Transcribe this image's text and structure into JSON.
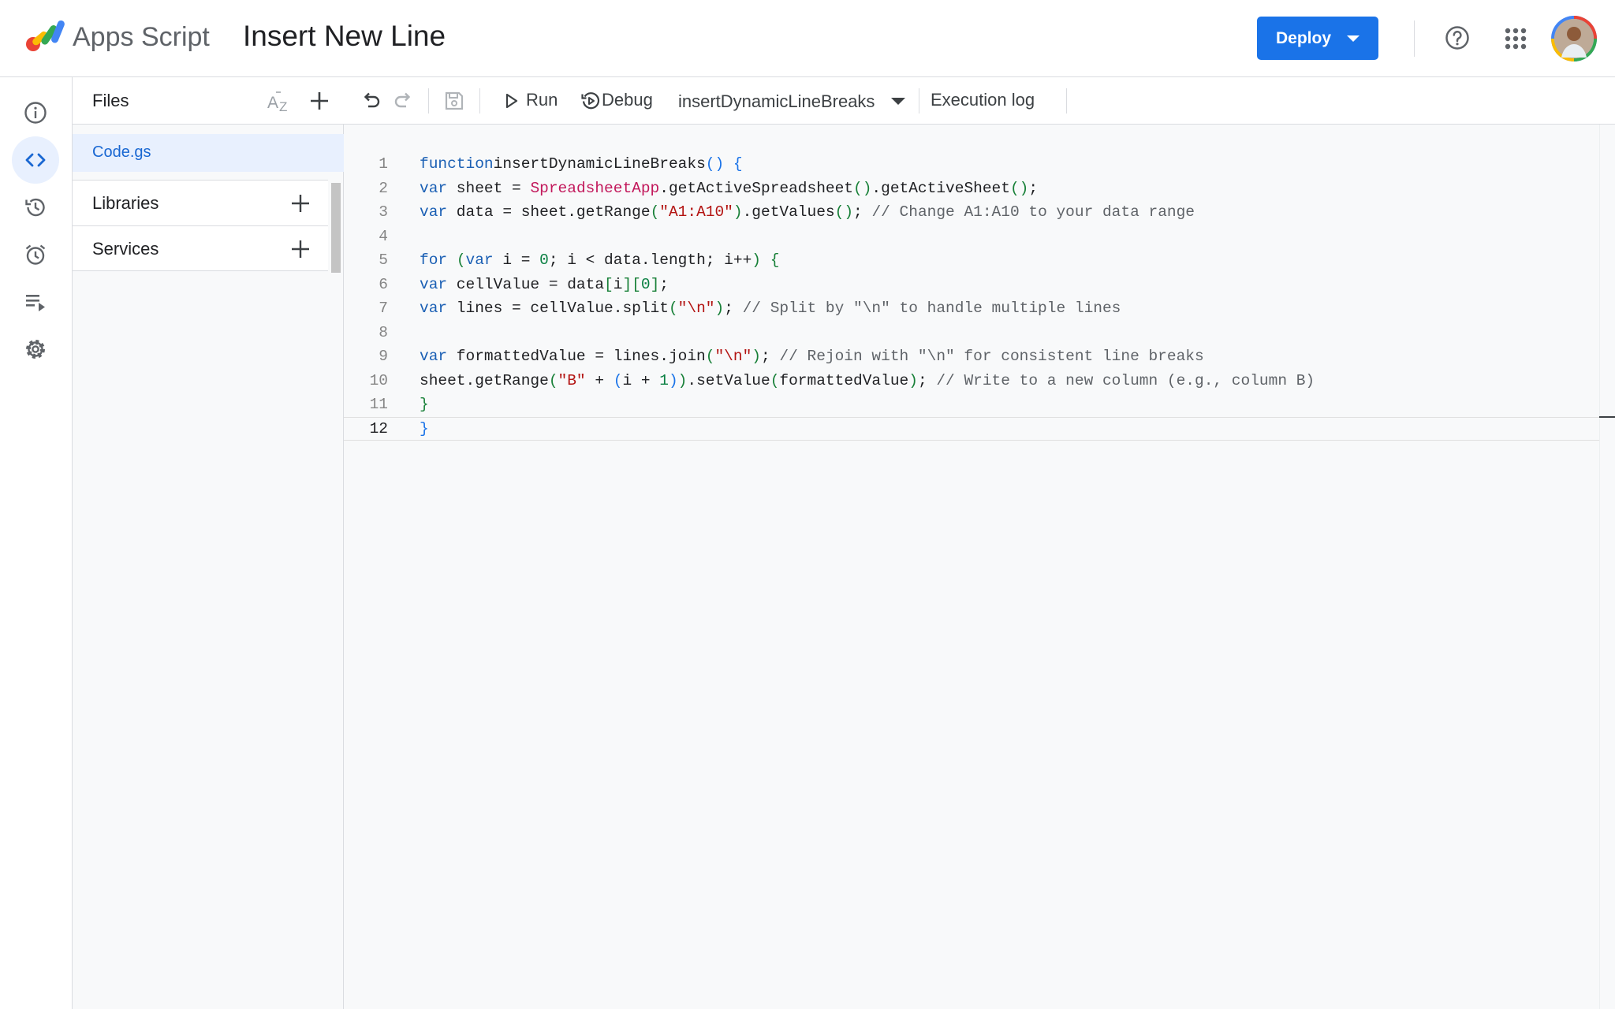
{
  "header": {
    "app_name": "Apps Script",
    "project_title": "Insert New Line",
    "deploy_label": "Deploy"
  },
  "leftnav": {
    "items": [
      {
        "name": "overview",
        "icon": "info-icon"
      },
      {
        "name": "editor",
        "icon": "code-icon",
        "active": true
      },
      {
        "name": "project-history",
        "icon": "history-icon"
      },
      {
        "name": "triggers",
        "icon": "alarm-clock-icon"
      },
      {
        "name": "executions",
        "icon": "executions-list-icon"
      },
      {
        "name": "project-settings",
        "icon": "gear-icon"
      }
    ]
  },
  "files_panel": {
    "title": "Files",
    "files": [
      "Code.gs"
    ],
    "libraries_label": "Libraries",
    "services_label": "Services"
  },
  "toolbar": {
    "run_label": "Run",
    "debug_label": "Debug",
    "function_name": "insertDynamicLineBreaks",
    "execution_log_label": "Execution log"
  },
  "editor": {
    "current_line": 12,
    "lines": [
      {
        "n": "1",
        "tokens": [
          [
            "kw",
            "function"
          ],
          [
            "",
            "insertDynamicLineBreaks"
          ],
          [
            "pb",
            "()"
          ],
          [
            "",
            " "
          ],
          [
            "pb",
            "{"
          ]
        ]
      },
      {
        "n": "2",
        "tokens": [
          [
            "kw",
            "var"
          ],
          [
            "",
            " sheet = "
          ],
          [
            "cls",
            "SpreadsheetApp"
          ],
          [
            "",
            ".getActiveSpreadsheet"
          ],
          [
            "pg",
            "()"
          ],
          [
            "",
            ".getActiveSheet"
          ],
          [
            "pg",
            "()"
          ],
          [
            "",
            ";"
          ]
        ]
      },
      {
        "n": "3",
        "tokens": [
          [
            "kw",
            "var"
          ],
          [
            "",
            " data = sheet.getRange"
          ],
          [
            "pg",
            "("
          ],
          [
            "str",
            "\"A1:A10\""
          ],
          [
            "pg",
            ")"
          ],
          [
            "",
            ".getValues"
          ],
          [
            "pg",
            "()"
          ],
          [
            "",
            "; "
          ],
          [
            "cm",
            "// Change A1:A10 to your data range"
          ]
        ]
      },
      {
        "n": "4",
        "tokens": []
      },
      {
        "n": "5",
        "tokens": [
          [
            "kw",
            "for"
          ],
          [
            "",
            " "
          ],
          [
            "pg",
            "("
          ],
          [
            "kw",
            "var"
          ],
          [
            "",
            " i = "
          ],
          [
            "num",
            "0"
          ],
          [
            "",
            "; i < data.length; i++"
          ],
          [
            "pg",
            ")"
          ],
          [
            "",
            " "
          ],
          [
            "pg",
            "{"
          ]
        ]
      },
      {
        "n": "6",
        "tokens": [
          [
            "kw",
            "var"
          ],
          [
            "",
            " cellValue = data"
          ],
          [
            "pg",
            "["
          ],
          [
            "",
            "i"
          ],
          [
            "pg",
            "]"
          ],
          [
            "pg",
            "["
          ],
          [
            "num",
            "0"
          ],
          [
            "pg",
            "]"
          ],
          [
            "",
            ";"
          ]
        ]
      },
      {
        "n": "7",
        "tokens": [
          [
            "kw",
            "var"
          ],
          [
            "",
            " lines = cellValue.split"
          ],
          [
            "pg",
            "("
          ],
          [
            "str",
            "\"\\n\""
          ],
          [
            "pg",
            ")"
          ],
          [
            "",
            "; "
          ],
          [
            "cm",
            "// Split by \"\\n\" to handle multiple lines"
          ]
        ]
      },
      {
        "n": "8",
        "tokens": []
      },
      {
        "n": "9",
        "tokens": [
          [
            "kw",
            "var"
          ],
          [
            "",
            " formattedValue = lines.join"
          ],
          [
            "pg",
            "("
          ],
          [
            "str",
            "\"\\n\""
          ],
          [
            "pg",
            ")"
          ],
          [
            "",
            "; "
          ],
          [
            "cm",
            "// Rejoin with \"\\n\" for consistent line breaks"
          ]
        ]
      },
      {
        "n": "10",
        "tokens": [
          [
            "",
            "sheet.getRange"
          ],
          [
            "pg",
            "("
          ],
          [
            "str",
            "\"B\""
          ],
          [
            "",
            " + "
          ],
          [
            "pb",
            "("
          ],
          [
            "",
            "i + "
          ],
          [
            "num",
            "1"
          ],
          [
            "pb",
            ")"
          ],
          [
            "pg",
            ")"
          ],
          [
            "",
            ".setValue"
          ],
          [
            "pg",
            "("
          ],
          [
            "",
            "formattedValue"
          ],
          [
            "pg",
            ")"
          ],
          [
            "",
            "; "
          ],
          [
            "cm",
            "// Write to a new column (e.g., column B)"
          ]
        ]
      },
      {
        "n": "11",
        "tokens": [
          [
            "pg",
            "}"
          ]
        ]
      },
      {
        "n": "12",
        "tokens": [
          [
            "pb",
            "}"
          ]
        ]
      }
    ]
  },
  "colors": {
    "accent": "#1a73e8",
    "keyword": "#1a5fb4",
    "string": "#b31412",
    "comment": "#5f6368",
    "class": "#c2185b"
  }
}
